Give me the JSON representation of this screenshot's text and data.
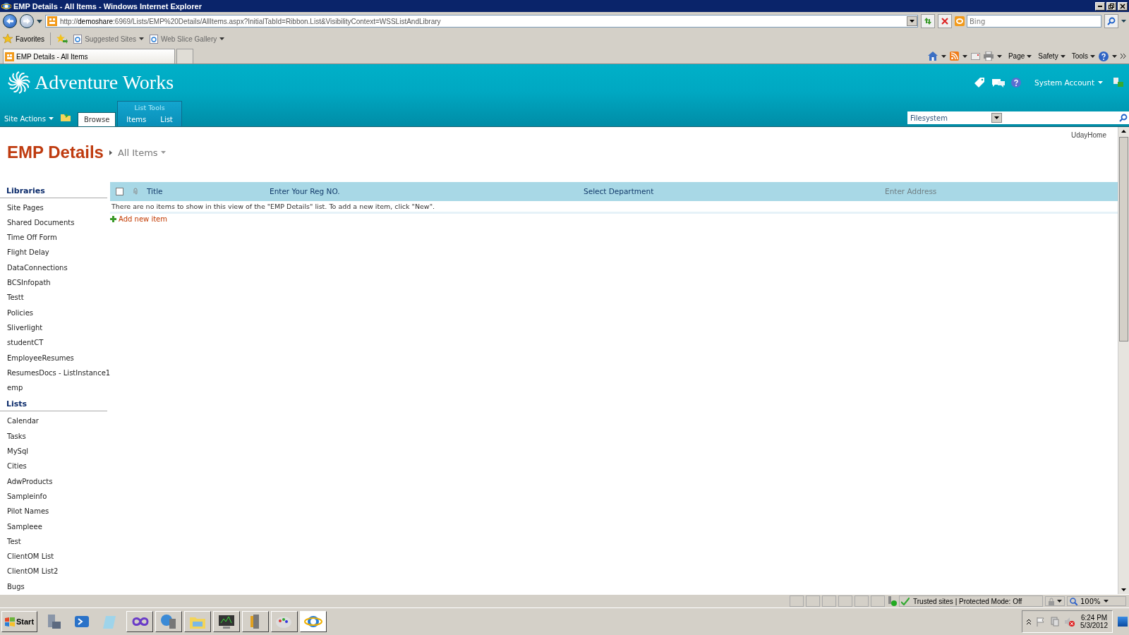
{
  "window": {
    "title": "EMP Details - All Items - Windows Internet Explorer"
  },
  "address_bar": {
    "url": "http://**demoshare**:6969/Lists/EMP%20Details/AllItems.aspx?InitialTabId=Ribbon.List&VisibilityContext=WSSListAndLibrary"
  },
  "search": {
    "placeholder": "Bing"
  },
  "favorites_bar": {
    "favorites": "Favorites",
    "links": [
      "Suggested Sites",
      "Web Slice Gallery"
    ]
  },
  "tabs": [
    {
      "label": "EMP Details - All Items",
      "selected": true
    }
  ],
  "command_bar": [
    "Page",
    "Safety",
    "Tools"
  ],
  "site": {
    "title": "Adventure Works",
    "site_actions": "Site Actions",
    "tool_group": "List Tools",
    "user": "System Account",
    "search_scope": "Filesystem",
    "home_link": "UdayHome",
    "ribbon_tabs": [
      {
        "label": "Browse",
        "selected": true
      },
      {
        "label": "Items",
        "selected": false
      },
      {
        "label": "List",
        "selected": false
      }
    ]
  },
  "page": {
    "title": "EMP Details",
    "view": "All Items"
  },
  "quick_launch": [
    {
      "heading": "Libraries",
      "items": [
        "Site Pages",
        "Shared Documents",
        "Time Off Form",
        "Flight Delay",
        "DataConnections",
        "BCSInfopath",
        "Testt",
        "Policies",
        "Sliverlight",
        "studentCT",
        "EmployeeResumes",
        "ResumesDocs - ListInstance1",
        "emp"
      ]
    },
    {
      "heading": "Lists",
      "items": [
        "Calendar",
        "Tasks",
        "MySql",
        "Cities",
        "AdwProducts",
        "Sampleinfo",
        "Pilot Names",
        "Sampleee",
        "Test",
        "ClientOM List",
        "ClientOM List2",
        "Bugs"
      ]
    }
  ],
  "list": {
    "columns": [
      {
        "label": "Title",
        "dimmed": false
      },
      {
        "label": "Enter Your Reg NO.",
        "dimmed": false
      },
      {
        "label": "Select Department",
        "dimmed": false
      },
      {
        "label": "Enter Address",
        "dimmed": true
      }
    ],
    "select_all": {
      "checked": false
    },
    "empty_message": "There are no items to show in this view of the \"EMP Details\" list. To add a new item, click \"New\".",
    "add_new": "Add new item"
  },
  "status_bar": {
    "zone": "Trusted sites | Protected Mode: Off",
    "zoom": "100%"
  },
  "taskbar": {
    "start": "Start",
    "time": "6:24 PM",
    "date": "5/3/2012"
  }
}
